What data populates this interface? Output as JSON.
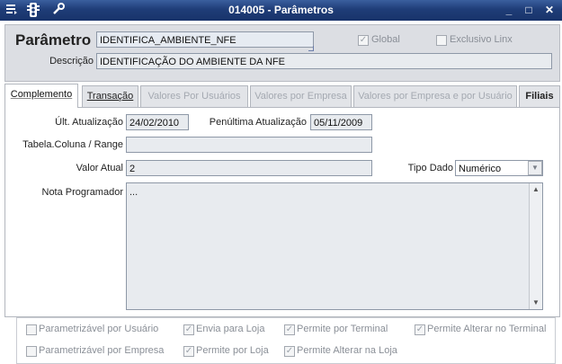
{
  "window": {
    "title": "014005 - Parâmetros",
    "controls": {
      "minimize": "_",
      "maximize": "□",
      "close": "✕"
    }
  },
  "header": {
    "parametro_label": "Parâmetro",
    "parametro_value": "IDENTIFICA_AMBIENTE_NFE",
    "descricao_label": "Descrição",
    "descricao_value": "IDENTIFICAÇÃO DO AMBIENTE DA NFE",
    "global_label": "Global",
    "global_checked": true,
    "exclusivo_label": "Exclusivo Linx",
    "exclusivo_checked": false
  },
  "tabs": [
    {
      "label": "Complemento",
      "active": true
    },
    {
      "label": "Transação",
      "active": false
    },
    {
      "label": "Valores Por Usuários",
      "active": false
    },
    {
      "label": "Valores por Empresa",
      "active": false
    },
    {
      "label": "Valores por Empresa e por Usuário",
      "active": false
    },
    {
      "label": "Filiais",
      "active": false
    }
  ],
  "complemento": {
    "ult_atualizacao_label": "Últ. Atualização",
    "ult_atualizacao_value": "24/02/2010",
    "penultima_label": "Penúltima Atualização",
    "penultima_value": "05/11/2009",
    "tabela_label": "Tabela.Coluna / Range",
    "tabela_value": "",
    "valor_atual_label": "Valor Atual",
    "valor_atual_value": "2",
    "tipo_dado_label": "Tipo Dado",
    "tipo_dado_value": "Numérico",
    "nota_label": "Nota Programador",
    "nota_value": "..."
  },
  "options": {
    "parametrizavel_usuario": {
      "label": "Parametrizável por Usuário",
      "checked": false
    },
    "envia_para_loja": {
      "label": "Envia para Loja",
      "checked": true
    },
    "permite_por_terminal": {
      "label": "Permite por Terminal",
      "checked": true
    },
    "permite_alterar_terminal": {
      "label": "Permite Alterar no Terminal",
      "checked": true
    },
    "parametrizavel_empresa": {
      "label": "Parametrizável por Empresa",
      "checked": false
    },
    "permite_por_loja": {
      "label": "Permite por Loja",
      "checked": true
    },
    "permite_alterar_loja": {
      "label": "Permite Alterar na Loja",
      "checked": true
    }
  },
  "colors": {
    "titlebar": "#1f3d78",
    "accent": "#2b4f8f"
  }
}
